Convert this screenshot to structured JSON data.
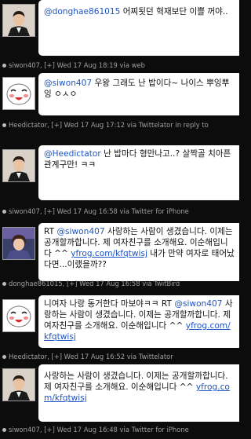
{
  "tweets": [
    {
      "avatar": "man-in-suit-avatar",
      "mention": "@donghae861015",
      "text": " 어찌됫던 혁재보단 이쁠 꺼야..",
      "meta": "siwon407, [+] Wed 17 Aug 18:19 via web"
    },
    {
      "avatar": "emoticon-face-avatar",
      "mention": "@siwon407",
      "text": " 우왕 그래도 난 밥이다~ 나이스 뿌잉뿌잉 ㅇㅅㅇ",
      "meta": "Heedictator, [+] Wed 17 Aug 17:12 via Twittelator in reply to"
    },
    {
      "avatar": "man-in-suit-avatar",
      "mention": "@Heedictator",
      "text": " 난 밥마다 형만나고..? 살짝골 치아픈관계구만! ㅋㅋ",
      "meta": "siwon407, [+] Wed 17 Aug 16:58 via Twitter for iPhone"
    },
    {
      "avatar": "donghae-photo-avatar",
      "prefix": "RT ",
      "mention": "@siwon407",
      "text": " 사랑하는 사람이 생겼습니다. 이제는 공개할까합니다. 제 여자친구를 소개해요. 이순해입니다 ^^ ",
      "link": "yfrog.com/kfqtwisj",
      "suffix": " 내가 만약 여자로 태어났다면...이랬을까??",
      "meta": "donghae861015, [+] Wed 17 Aug 16:58 via TwitBird"
    },
    {
      "avatar": "emoticon-face-avatar",
      "prefix": "니여자 나랑 동거한다 마보야ㅋㅋ RT ",
      "mention": "@siwon407",
      "text": " 사랑하는 사람이 생겼습니다. 이제는 공개할까합니다. 제 여자친구를 소개해요. 이순해입니다 ^^ ",
      "link": "yfrog.com/kfqtwisj",
      "meta": "Heedictator, [+] Wed 17 Aug 16:52 via Twittelator"
    },
    {
      "avatar": "man-in-suit-avatar",
      "text": "사랑하는 사람이 생겼습니다. 이제는 공개할까합니다. 제 여자친구를 소개해요. 이순해입니다 ^^ ",
      "link": "yfrog.com/kfqtwisj",
      "meta": "siwon407, [+] Wed 17 Aug 16:48 via Twitter for iPhone"
    }
  ],
  "colors": {
    "background": "#0c0c0c",
    "bubble": "#ffffff",
    "link": "#1d55c4",
    "meta_text": "#a0a0a0"
  }
}
